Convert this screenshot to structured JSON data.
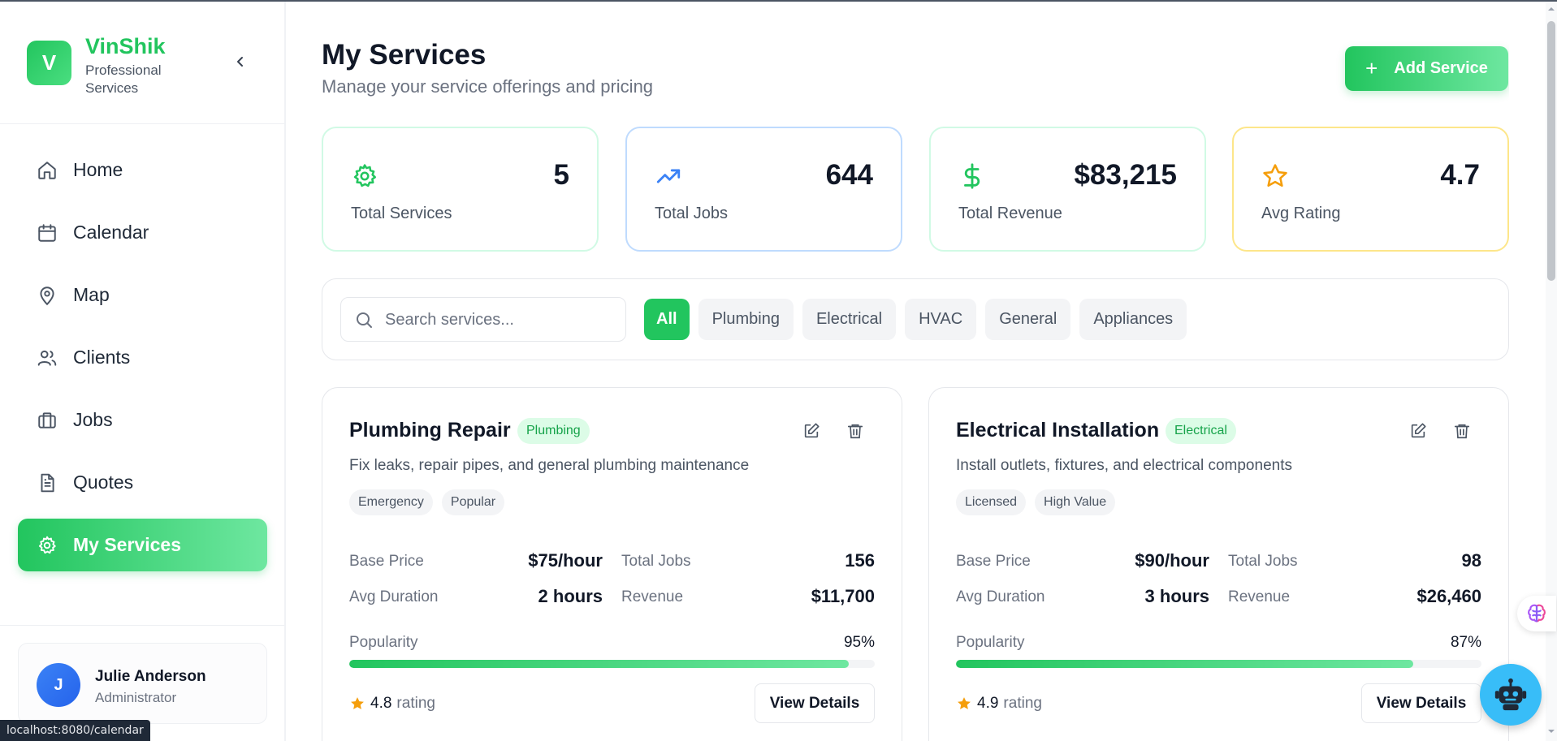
{
  "brand": {
    "logo_letter": "V",
    "name": "VinShik",
    "subtitle": "Professional Services"
  },
  "sidebar": {
    "items": [
      {
        "label": "Home",
        "icon": "home-icon"
      },
      {
        "label": "Calendar",
        "icon": "calendar-icon"
      },
      {
        "label": "Map",
        "icon": "map-pin-icon"
      },
      {
        "label": "Clients",
        "icon": "users-icon"
      },
      {
        "label": "Jobs",
        "icon": "briefcase-icon"
      },
      {
        "label": "Quotes",
        "icon": "document-icon"
      },
      {
        "label": "My Services",
        "icon": "gear-icon",
        "active": true
      }
    ]
  },
  "user": {
    "initial": "J",
    "name": "Julie Anderson",
    "role": "Administrator"
  },
  "status_url": "localhost:8080/calendar",
  "header": {
    "title": "My Services",
    "subtitle": "Manage your service offerings and pricing",
    "add_button": "Add Service"
  },
  "stats": [
    {
      "value": "5",
      "label": "Total Services",
      "icon": "gear-icon",
      "color": "#22c55e"
    },
    {
      "value": "644",
      "label": "Total Jobs",
      "icon": "trending-up-icon",
      "color": "#3b82f6"
    },
    {
      "value": "$83,215",
      "label": "Total Revenue",
      "icon": "dollar-icon",
      "color": "#22c55e"
    },
    {
      "value": "4.7",
      "label": "Avg Rating",
      "icon": "star-icon",
      "color": "#f59e0b"
    }
  ],
  "filters": {
    "search_placeholder": "Search services...",
    "search_value": "",
    "chips": [
      "All",
      "Plumbing",
      "Electrical",
      "HVAC",
      "General",
      "Appliances"
    ],
    "active_chip": "All"
  },
  "services": [
    {
      "title": "Plumbing Repair",
      "category": "Plumbing",
      "description": "Fix leaks, repair pipes, and general plumbing maintenance",
      "tags": [
        "Emergency",
        "Popular"
      ],
      "base_price_label": "Base Price",
      "base_price": "$75/hour",
      "total_jobs_label": "Total Jobs",
      "total_jobs": "156",
      "avg_duration_label": "Avg Duration",
      "avg_duration": "2 hours",
      "revenue_label": "Revenue",
      "revenue": "$11,700",
      "popularity_label": "Popularity",
      "popularity": "95%",
      "popularity_value": 95,
      "rating": "4.8",
      "rating_suffix": "rating",
      "view_label": "View Details"
    },
    {
      "title": "Electrical Installation",
      "category": "Electrical",
      "description": "Install outlets, fixtures, and electrical components",
      "tags": [
        "Licensed",
        "High Value"
      ],
      "base_price_label": "Base Price",
      "base_price": "$90/hour",
      "total_jobs_label": "Total Jobs",
      "total_jobs": "98",
      "avg_duration_label": "Avg Duration",
      "avg_duration": "3 hours",
      "revenue_label": "Revenue",
      "revenue": "$26,460",
      "popularity_label": "Popularity",
      "popularity": "87%",
      "popularity_value": 87,
      "rating": "4.9",
      "rating_suffix": "rating",
      "view_label": "View Details"
    }
  ],
  "colors": {
    "accent": "#22c55e",
    "star": "#f59e0b",
    "blue": "#3b82f6"
  }
}
